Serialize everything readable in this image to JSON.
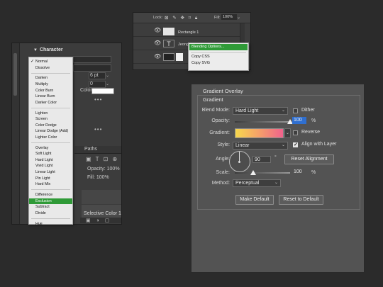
{
  "left_panel": {
    "title": "Character",
    "font_size_value": "6 pt",
    "tracking_value": "0",
    "color_label": "Color",
    "paths_tab": "Paths",
    "opacity_label": "Opacity:",
    "opacity_value": "100%",
    "fill_label": "Fill:",
    "fill_value": "100%",
    "layer_name": "Selective Color 1",
    "blend_modes": [
      [
        "Normal",
        "Dissolve"
      ],
      [
        "Darken",
        "Multiply",
        "Color Burn",
        "Linear Burn",
        "Darker Color"
      ],
      [
        "Lighten",
        "Screen",
        "Color Dodge",
        "Linear Dodge (Add)",
        "Lighter Color"
      ],
      [
        "Overlay",
        "Soft Light",
        "Hard Light",
        "Vivid Light",
        "Linear Light",
        "Pin Light",
        "Hard Mix"
      ],
      [
        "Difference",
        "Exclusion",
        "Subtract",
        "Divide"
      ],
      [
        "Hue"
      ]
    ],
    "checked_mode": "Normal",
    "highlighted_mode": "Exclusion"
  },
  "layers_panel": {
    "lock_label": "Lock:",
    "fill_label": "Fill:",
    "fill_value": "100%",
    "layers": [
      {
        "name": "Rectangle 1"
      },
      {
        "name": "Jeongho"
      }
    ]
  },
  "context_menu": {
    "items": [
      "Blending Options...",
      "Copy CSS",
      "Copy SVG"
    ],
    "highlighted": "Blending Options..."
  },
  "gradient_overlay": {
    "title": "Gradient Overlay",
    "subtitle": "Gradient",
    "blend_mode_label": "Blend Mode:",
    "blend_mode_value": "Hard Light",
    "dither_label": "Dither",
    "dither_checked": false,
    "opacity_label": "Opacity:",
    "opacity_value": "100",
    "opacity_fraction": 1.0,
    "percent_unit": "%",
    "gradient_label": "Gradient:",
    "reverse_label": "Reverse",
    "reverse_checked": false,
    "style_label": "Style:",
    "style_value": "Linear",
    "align_label": "Align with Layer",
    "align_checked": true,
    "angle_label": "Angle:",
    "angle_value": "90",
    "degree_unit": "°",
    "reset_alignment_label": "Reset Alignment",
    "scale_label": "Scale:",
    "scale_value": "100",
    "scale_fraction": 0.33,
    "method_label": "Method:",
    "method_value": "Perceptual",
    "make_default_label": "Make Default",
    "reset_default_label": "Reset to Default",
    "gradient_colors": [
      "#f6d84d",
      "#f6a06a",
      "#f1628c"
    ],
    "accent_color": "#2f9a37"
  }
}
